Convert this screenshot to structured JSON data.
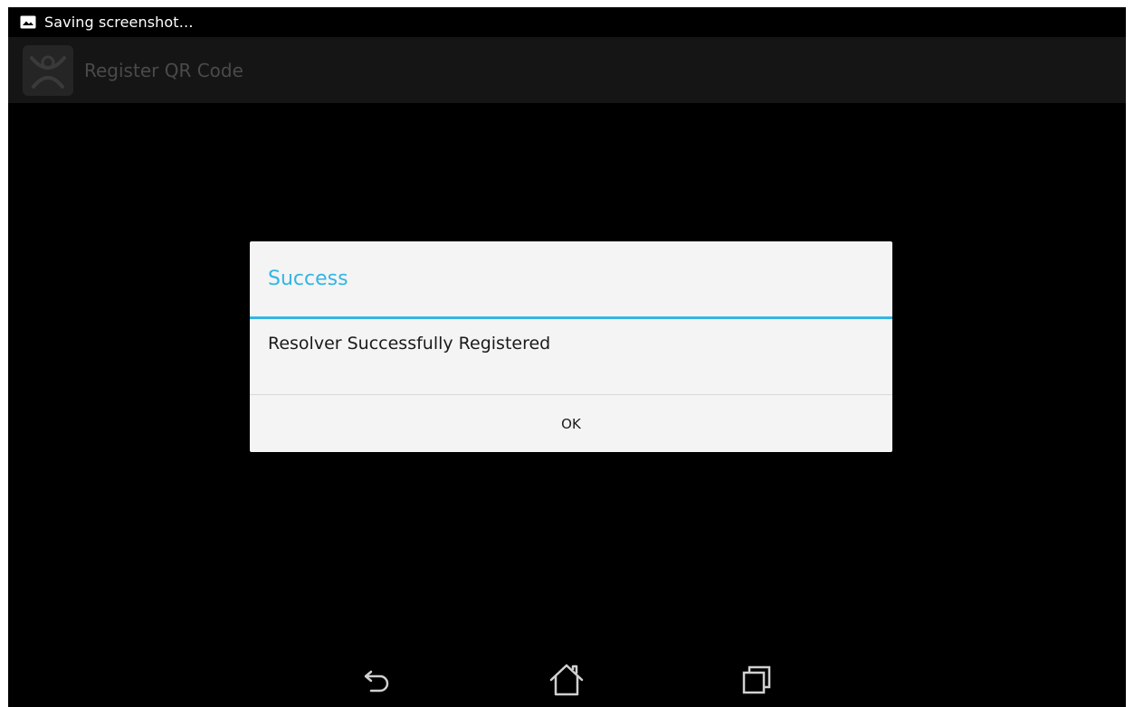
{
  "status_bar": {
    "notification_icon": "image-icon",
    "text": "Saving screenshot…"
  },
  "action_bar": {
    "app_icon": "app-logo-icon",
    "title": "Register QR Code"
  },
  "dialog": {
    "title": "Success",
    "message": "Resolver Successfully Registered",
    "ok_label": "OK",
    "accent_color": "#33b5e5"
  },
  "nav_bar": {
    "back_icon": "back-icon",
    "home_icon": "home-icon",
    "recents_icon": "recent-apps-icon"
  }
}
